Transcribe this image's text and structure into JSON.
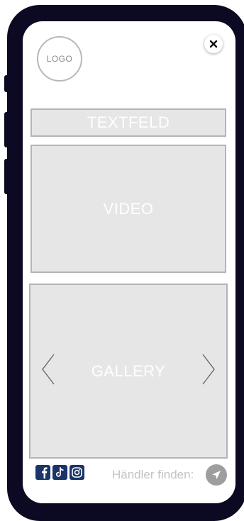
{
  "header": {
    "logo_text": "LOGO",
    "close_icon": "close-icon"
  },
  "content": {
    "textfield_label": "TEXTFELD",
    "video_label": "VIDEO",
    "gallery_label": "GALLERY"
  },
  "footer": {
    "social_icons": [
      "facebook-icon",
      "tiktok-icon",
      "instagram-icon"
    ],
    "dealer_label": "Händler finden:",
    "dealer_icon": "navigation-arrow-icon"
  },
  "colors": {
    "device_frame": "#0b0a22",
    "placeholder_fill": "#e6e6e6",
    "placeholder_border": "#b4b4b4",
    "social_blue": "#1c3468",
    "dealer_button": "#9e9e9e"
  }
}
